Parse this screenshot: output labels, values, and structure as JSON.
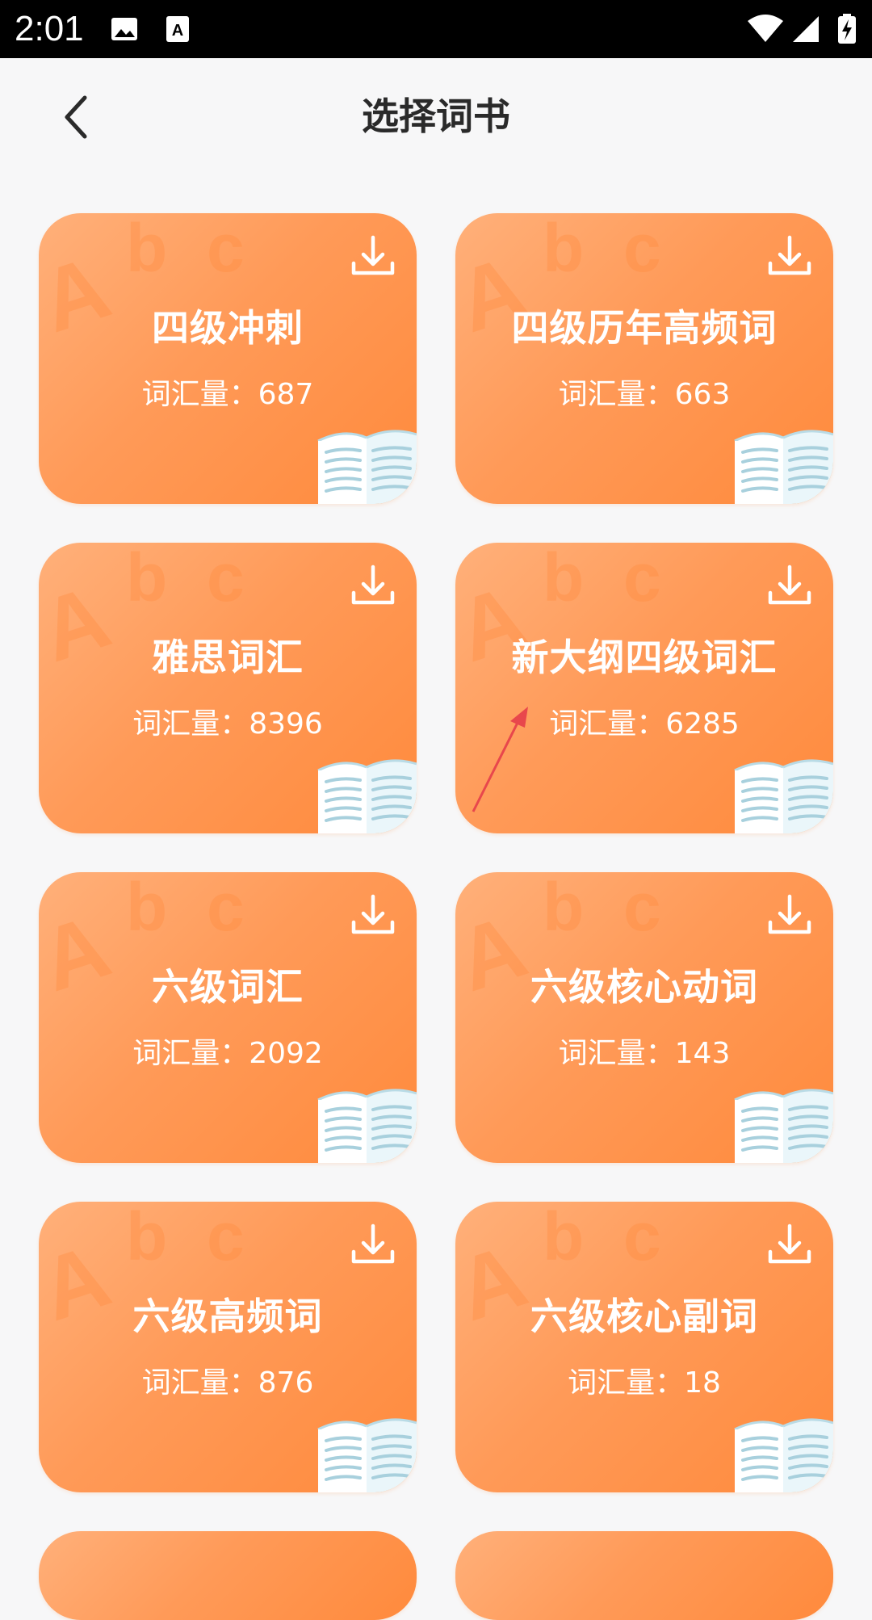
{
  "status_bar": {
    "time": "2:01",
    "icons": [
      "image-icon",
      "text-a-icon",
      "wifi-icon",
      "cell-signal-icon",
      "battery-charging-icon"
    ]
  },
  "header": {
    "title": "选择词书",
    "back_icon": "chevron-left-icon"
  },
  "colors": {
    "card_gradient_start": "#ffb07a",
    "card_gradient_end": "#ff8a3c",
    "title_text": "#2a2a2a",
    "annotation_arrow": "#e8474c"
  },
  "books": [
    {
      "title": "四级冲刺",
      "count_label": "词汇量：687"
    },
    {
      "title": "四级历年高频词",
      "count_label": "词汇量：663"
    },
    {
      "title": "雅思词汇",
      "count_label": "词汇量：8396"
    },
    {
      "title": "新大纲四级词汇",
      "count_label": "词汇量：6285"
    },
    {
      "title": "六级词汇",
      "count_label": "词汇量：2092"
    },
    {
      "title": "六级核心动词",
      "count_label": "词汇量：143"
    },
    {
      "title": "六级高频词",
      "count_label": "词汇量：876"
    },
    {
      "title": "六级核心副词",
      "count_label": "词汇量：18"
    }
  ],
  "card_decoration_letters": [
    "A",
    "b",
    "c"
  ]
}
